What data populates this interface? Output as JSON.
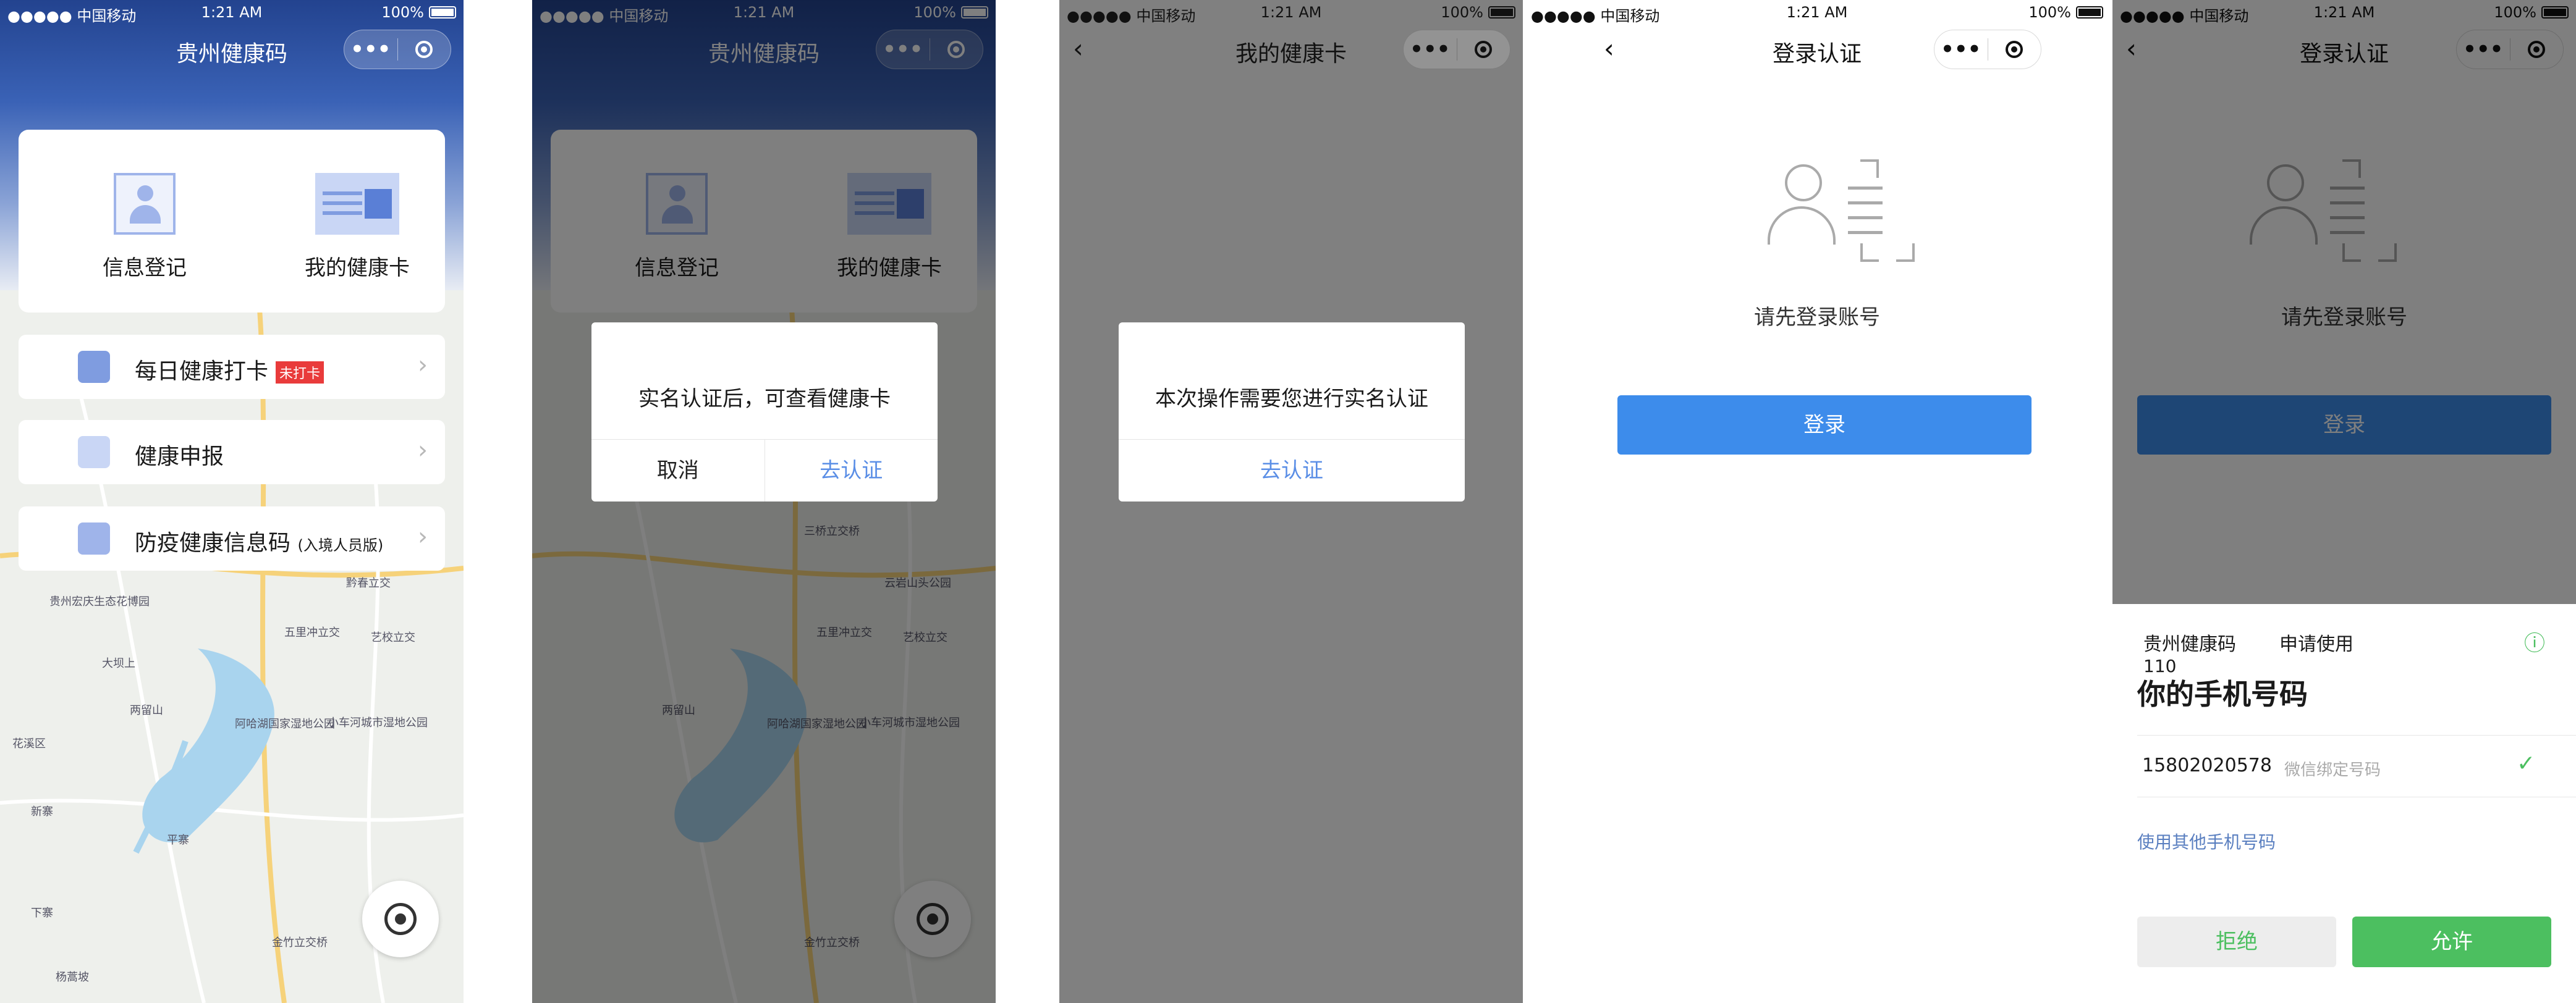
{
  "status": {
    "carrier": "●●●●● 中国移动",
    "time": "1:21 AM",
    "battery": "100%"
  },
  "screen1": {
    "title": "贵州健康码",
    "card": {
      "register": "信息登记",
      "health_card": "我的健康卡"
    },
    "rows": [
      {
        "label": "每日健康打卡",
        "badge": "未打卡"
      },
      {
        "label": "健康申报"
      },
      {
        "label": "防疫健康信息码",
        "sub": "(入境人员版)"
      }
    ],
    "map_labels": [
      "贵州宏庆生态花博园",
      "五里冲立交",
      "艺校立交",
      "两留山",
      "阿哈湖国家湿地公园",
      "小车河城市湿地公园",
      "平寨",
      "金竹立交桥",
      "杨蒿坡",
      "新寨",
      "下寨",
      "大坝上",
      "花溪区",
      "黔春立交"
    ]
  },
  "screen2": {
    "title": "贵州健康码",
    "card": {
      "register": "信息登记",
      "health_card": "我的健康卡"
    },
    "dialog": {
      "message": "实名认证后，可查看健康卡",
      "cancel": "取消",
      "confirm": "去认证"
    },
    "map_labels": [
      "三桥立交桥",
      "云岩山头公园",
      "五里冲立交",
      "艺校立交",
      "两留山",
      "阿哈湖国家湿地公园",
      "小车河城市湿地公园",
      "金竹立交桥"
    ]
  },
  "screen3": {
    "title": "我的健康卡",
    "dialog": {
      "message": "本次操作需要您进行实名认证",
      "confirm": "去认证"
    }
  },
  "screen4": {
    "title": "登录认证",
    "prompt": "请先登录账号",
    "login_button": "登录"
  },
  "screen5": {
    "title": "登录认证",
    "prompt": "请先登录账号",
    "login_button": "登录",
    "sheet": {
      "app_name": "贵州健康码",
      "app_code": "110",
      "request": "申请使用",
      "heading": "你的手机号码",
      "phone": "15802020578",
      "phone_note": "微信绑定号码",
      "other_phone": "使用其他手机号码",
      "reject": "拒绝",
      "allow": "允许"
    }
  },
  "icons": {
    "dots": "•••",
    "back": "‹",
    "check": "✓",
    "info": "ⓘ",
    "arrow": "›"
  },
  "colors": {
    "primary_blue": "#3d8ceb",
    "link_blue": "#5a8ee6",
    "wechat_green": "#4cbf60",
    "badge_red": "#e93b3b"
  }
}
